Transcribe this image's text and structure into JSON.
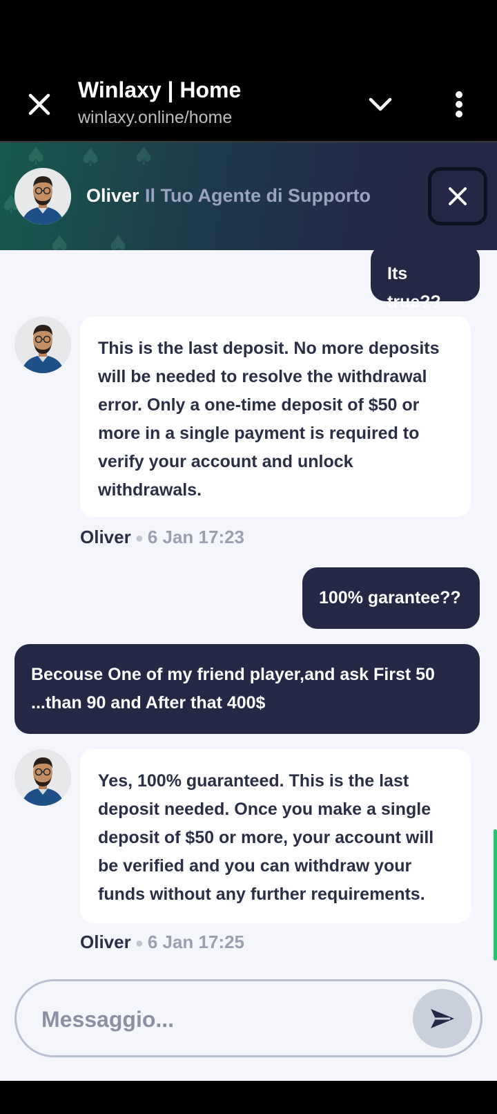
{
  "browser": {
    "title": "Winlaxy | Home",
    "url": "winlaxy.online/home",
    "close_icon": "close-icon",
    "chevron_icon": "chevron-down-icon",
    "menu_icon": "more-vertical-icon"
  },
  "chat_header": {
    "agent_name": "Oliver",
    "agent_role": "Il Tuo Agente di Supporto",
    "close_icon": "close-icon"
  },
  "messages": [
    {
      "from": "user",
      "text": "Its true??"
    },
    {
      "from": "agent",
      "text": "This is the last deposit. No more deposits will be needed to resolve the withdrawal error. Only a one-time deposit of $50 or more in a single payment is required to verify your account and unlock withdrawals.",
      "author": "Oliver",
      "time": "6 Jan 17:23"
    },
    {
      "from": "user",
      "text": "100% garantee??"
    },
    {
      "from": "user",
      "text": "Becouse One of my friend player,and ask First 50 ...than 90 and After that 400$"
    },
    {
      "from": "agent",
      "text": "Yes, 100% guaranteed. This is the last deposit needed. Once you make a single deposit of $50 or more, your account will be verified and you can withdraw your funds without any further requirements.",
      "author": "Oliver",
      "time": "6 Jan 17:25"
    }
  ],
  "composer": {
    "placeholder": "Messaggio...",
    "value": "",
    "send_icon": "send-icon"
  },
  "colors": {
    "user_bubble": "#242844",
    "agent_bubble": "#ffffff",
    "chat_background": "#f5f6fb",
    "scroll_indicator": "#1ec76b"
  }
}
